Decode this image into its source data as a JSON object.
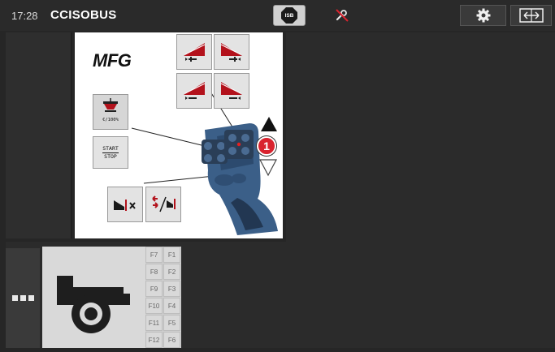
{
  "topbar": {
    "time": "17:28",
    "brand": "CCISOBUS",
    "isb_label": "ISB"
  },
  "colors": {
    "background": "#262626",
    "panel": "#2b2b2b",
    "accent_red": "#d9232e",
    "white": "#ffffff"
  },
  "main": {
    "logo": "MFG",
    "start_stop_top": "START",
    "start_stop_bottom": "STOP",
    "percent_label": "€/100%",
    "level_badge": "1",
    "icons": [
      "increase-left-icon",
      "increase-right-icon",
      "decrease-left-icon",
      "decrease-right-icon",
      "boundary-spreading-icon",
      "side-switch-icon",
      "arrow-up-icon",
      "arrow-down-icon",
      "joystick-image"
    ]
  },
  "bottom": {
    "function_keys_left": [
      "F7",
      "F8",
      "F9",
      "F10",
      "F11",
      "F12"
    ],
    "function_keys_right": [
      "F1",
      "F2",
      "F3",
      "F4",
      "F5",
      "F6"
    ]
  }
}
